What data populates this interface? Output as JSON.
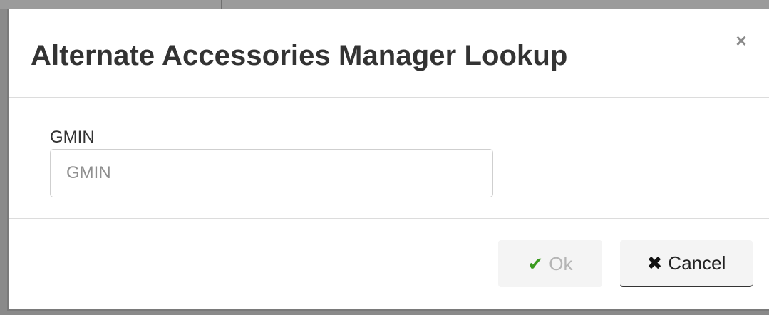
{
  "dialog": {
    "title": "Alternate Accessories Manager Lookup",
    "close_icon": "×"
  },
  "form": {
    "gmin_label": "GMIN",
    "gmin_placeholder": "GMIN",
    "gmin_value": ""
  },
  "footer": {
    "ok_icon": "✔",
    "ok_label": "Ok",
    "ok_enabled": false,
    "cancel_icon": "✖",
    "cancel_label": "Cancel"
  },
  "colors": {
    "ok_icon": "#3a9a1f",
    "disabled_text": "#b5b5b5",
    "title_text": "#333333"
  }
}
